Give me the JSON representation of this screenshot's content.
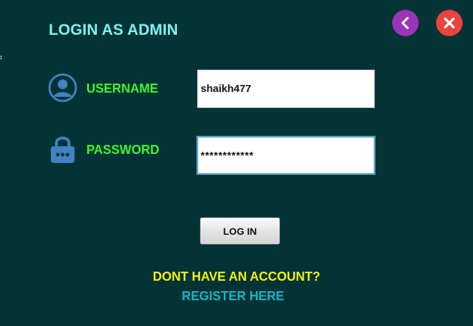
{
  "header": {
    "title": "LOGIN AS ADMIN"
  },
  "controls": {
    "back_icon": "chevron-left-icon",
    "close_icon": "close-icon",
    "back_color": "#9b34b8",
    "close_color": "#e8433f"
  },
  "form": {
    "username": {
      "label": "USERNAME",
      "value": "shaikh477",
      "icon": "user-icon"
    },
    "password": {
      "label": "PASSWORD",
      "value": "************",
      "icon": "lock-icon"
    },
    "login_button": "LOG IN"
  },
  "footer": {
    "prompt": "DONT HAVE AN ACCOUNT?",
    "register_link": "REGISTER HERE"
  },
  "colors": {
    "background": "#043336",
    "title": "#7ef2f0",
    "labels": "#3ef52c",
    "prompt": "#f4f20f",
    "link": "#18b6c2"
  }
}
